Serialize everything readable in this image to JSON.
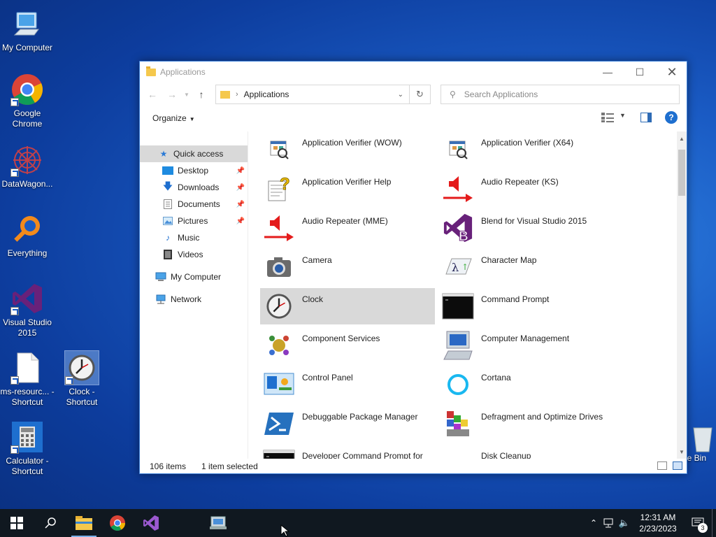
{
  "desktop": {
    "icons": [
      {
        "label": "My Computer"
      },
      {
        "label": "Google Chrome"
      },
      {
        "label": "DataWagon..."
      },
      {
        "label": "Everything"
      },
      {
        "label": "Visual Studio 2015"
      },
      {
        "label": "ms-resourc... - Shortcut"
      },
      {
        "label": "Clock - Shortcut"
      },
      {
        "label": "Calculator - Shortcut"
      },
      {
        "label": "e Bin"
      }
    ]
  },
  "window": {
    "title": "Applications",
    "address": {
      "path": "Applications"
    },
    "search": {
      "placeholder": "Search Applications"
    },
    "organize_label": "Organize",
    "help_label": "?",
    "nav": {
      "quick_access": "Quick access",
      "items": [
        {
          "label": "Desktop",
          "pinned": true
        },
        {
          "label": "Downloads",
          "pinned": true
        },
        {
          "label": "Documents",
          "pinned": true
        },
        {
          "label": "Pictures",
          "pinned": true
        },
        {
          "label": "Music",
          "pinned": false
        },
        {
          "label": "Videos",
          "pinned": false
        }
      ],
      "my_computer": "My Computer",
      "network": "Network"
    },
    "apps": [
      {
        "name": "Application Verifier (WOW)",
        "icon": "app-verifier-icon"
      },
      {
        "name": "Application Verifier (X64)",
        "icon": "app-verifier-icon"
      },
      {
        "name": "Application Verifier Help",
        "icon": "help-file-icon"
      },
      {
        "name": "Audio Repeater (KS)",
        "icon": "audio-repeater-icon"
      },
      {
        "name": "Audio Repeater (MME)",
        "icon": "audio-repeater-icon"
      },
      {
        "name": "Blend for Visual Studio 2015",
        "icon": "blend-icon"
      },
      {
        "name": "Camera",
        "icon": "camera-icon"
      },
      {
        "name": "Character Map",
        "icon": "character-map-icon"
      },
      {
        "name": "Clock",
        "icon": "clock-icon"
      },
      {
        "name": "Command Prompt",
        "icon": "command-prompt-icon"
      },
      {
        "name": "Component Services",
        "icon": "component-services-icon"
      },
      {
        "name": "Computer Management",
        "icon": "computer-management-icon"
      },
      {
        "name": "Control Panel",
        "icon": "control-panel-icon"
      },
      {
        "name": "Cortana",
        "icon": "cortana-icon"
      },
      {
        "name": "Debuggable Package Manager",
        "icon": "powershell-icon"
      },
      {
        "name": "Defragment and Optimize Drives",
        "icon": "defrag-icon"
      },
      {
        "name": "Developer Command Prompt for",
        "icon": "command-prompt-icon"
      },
      {
        "name": "Disk Cleanup",
        "icon": "disk-cleanup-icon"
      }
    ],
    "selected_app": "Clock",
    "status": {
      "item_count": "106 items",
      "selected": "1 item selected"
    }
  },
  "taskbar": {
    "time": "12:31 AM",
    "date": "2/23/2023",
    "notification_count": "3"
  },
  "colors": {
    "accent": "#1e6fcf",
    "selection": "#d9d9d9",
    "taskbar": "#101820"
  }
}
